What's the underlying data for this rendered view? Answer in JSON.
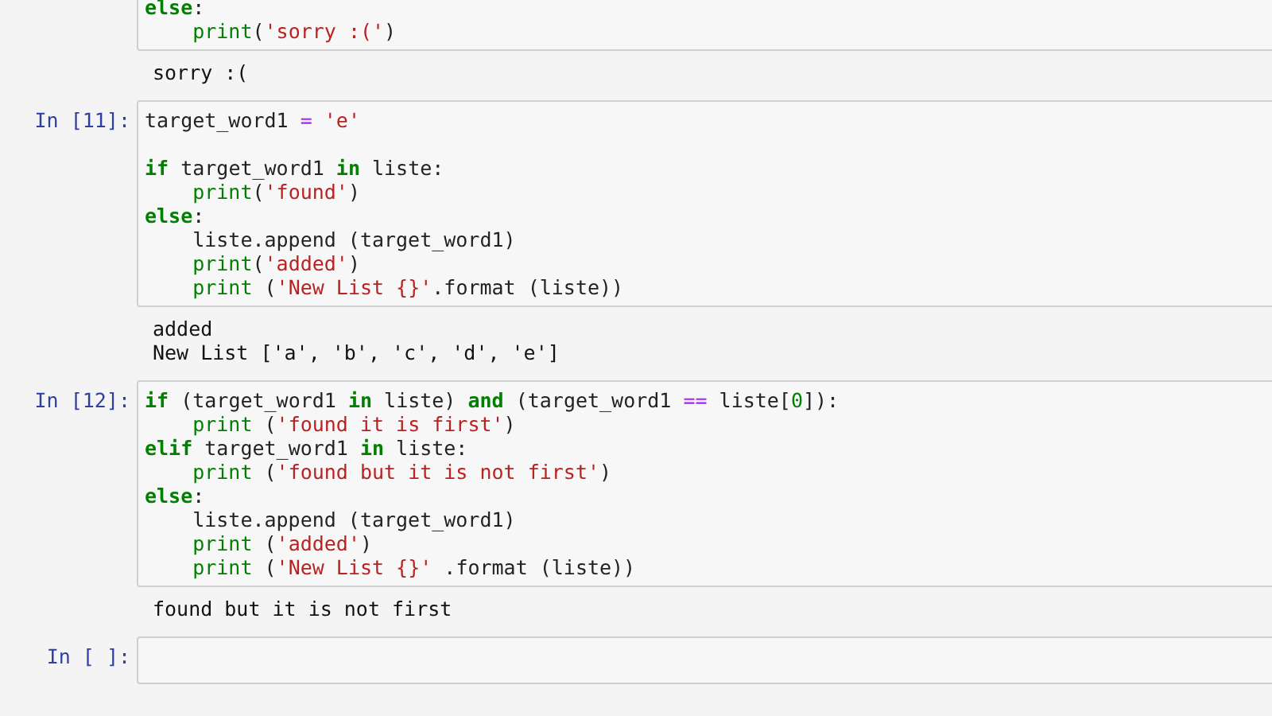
{
  "cells": [
    {
      "lines": [
        {
          "tokens": [
            {
              "kind": "kw",
              "text": "else"
            },
            {
              "kind": "plain",
              "text": ":"
            }
          ]
        },
        {
          "indented": true,
          "tokens": [
            {
              "kind": "builtin",
              "text": "print"
            },
            {
              "kind": "plain",
              "text": "("
            },
            {
              "kind": "str",
              "text": "'sorry :('"
            },
            {
              "kind": "plain",
              "text": ")"
            }
          ]
        }
      ],
      "output": [
        "sorry :("
      ]
    },
    {
      "prompt": "In [11]:",
      "lines": [
        {
          "tokens": [
            {
              "kind": "plain",
              "text": "target_word1 "
            },
            {
              "kind": "op",
              "text": "="
            },
            {
              "kind": "str",
              "text": " 'e'"
            }
          ]
        },
        {
          "blank_before": true,
          "tokens": [
            {
              "kind": "kw",
              "text": "if"
            },
            {
              "kind": "plain",
              "text": " target_word1 "
            },
            {
              "kind": "kw",
              "text": "in"
            },
            {
              "kind": "plain",
              "text": " liste:"
            }
          ]
        },
        {
          "indented": true,
          "tokens": [
            {
              "kind": "builtin",
              "text": "print"
            },
            {
              "kind": "plain",
              "text": "("
            },
            {
              "kind": "str",
              "text": "'found'"
            },
            {
              "kind": "plain",
              "text": ")"
            }
          ]
        },
        {
          "tokens": [
            {
              "kind": "kw",
              "text": "else"
            },
            {
              "kind": "plain",
              "text": ":"
            }
          ]
        },
        {
          "indented": true,
          "tokens": [
            {
              "kind": "plain",
              "text": "liste.append (target_word1)"
            }
          ]
        },
        {
          "indented": true,
          "tokens": [
            {
              "kind": "builtin",
              "text": "print"
            },
            {
              "kind": "plain",
              "text": "("
            },
            {
              "kind": "str",
              "text": "'added'"
            },
            {
              "kind": "plain",
              "text": ")"
            }
          ]
        },
        {
          "indented": true,
          "tokens": [
            {
              "kind": "builtin",
              "text": "print"
            },
            {
              "kind": "plain",
              "text": " ("
            },
            {
              "kind": "str",
              "text": "'New List {}'"
            },
            {
              "kind": "plain",
              "text": ".format (liste))"
            }
          ]
        }
      ],
      "output": [
        "added",
        "New List ['a', 'b', 'c', 'd', 'e']"
      ]
    },
    {
      "prompt": "In [12]:",
      "lines": [
        {
          "tokens": [
            {
              "kind": "kw",
              "text": "if"
            },
            {
              "kind": "plain",
              "text": " (target_word1 "
            },
            {
              "kind": "kw",
              "text": "in"
            },
            {
              "kind": "plain",
              "text": " liste) "
            },
            {
              "kind": "kw",
              "text": "and"
            },
            {
              "kind": "plain",
              "text": " (target_word1 "
            },
            {
              "kind": "op",
              "text": "=="
            },
            {
              "kind": "plain",
              "text": " liste["
            },
            {
              "kind": "num",
              "text": "0"
            },
            {
              "kind": "plain",
              "text": "]):"
            }
          ]
        },
        {
          "indented": true,
          "tokens": [
            {
              "kind": "builtin",
              "text": "print"
            },
            {
              "kind": "plain",
              "text": " ("
            },
            {
              "kind": "str",
              "text": "'found it is first'"
            },
            {
              "kind": "plain",
              "text": ")"
            }
          ]
        },
        {
          "tokens": [
            {
              "kind": "kw",
              "text": "elif"
            },
            {
              "kind": "plain",
              "text": " target_word1 "
            },
            {
              "kind": "kw",
              "text": "in"
            },
            {
              "kind": "plain",
              "text": " liste:"
            }
          ]
        },
        {
          "indented": true,
          "tokens": [
            {
              "kind": "builtin",
              "text": "print"
            },
            {
              "kind": "plain",
              "text": " ("
            },
            {
              "kind": "str",
              "text": "'found but it is not first'"
            },
            {
              "kind": "plain",
              "text": ")"
            }
          ]
        },
        {
          "tokens": [
            {
              "kind": "kw",
              "text": "else"
            },
            {
              "kind": "plain",
              "text": ":"
            }
          ]
        },
        {
          "indented": true,
          "tokens": [
            {
              "kind": "plain",
              "text": "liste.append (target_word1)"
            }
          ]
        },
        {
          "indented": true,
          "tokens": [
            {
              "kind": "builtin",
              "text": "print"
            },
            {
              "kind": "plain",
              "text": " ("
            },
            {
              "kind": "str",
              "text": "'added'"
            },
            {
              "kind": "plain",
              "text": ")"
            }
          ]
        },
        {
          "indented": true,
          "tokens": [
            {
              "kind": "builtin",
              "text": "print"
            },
            {
              "kind": "plain",
              "text": " ("
            },
            {
              "kind": "str",
              "text": "'New List {}'"
            },
            {
              "kind": "plain",
              "text": " .format (liste))"
            }
          ]
        }
      ],
      "output": [
        "found but it is not first"
      ]
    },
    {
      "prompt": "In [ ]:"
    }
  ]
}
